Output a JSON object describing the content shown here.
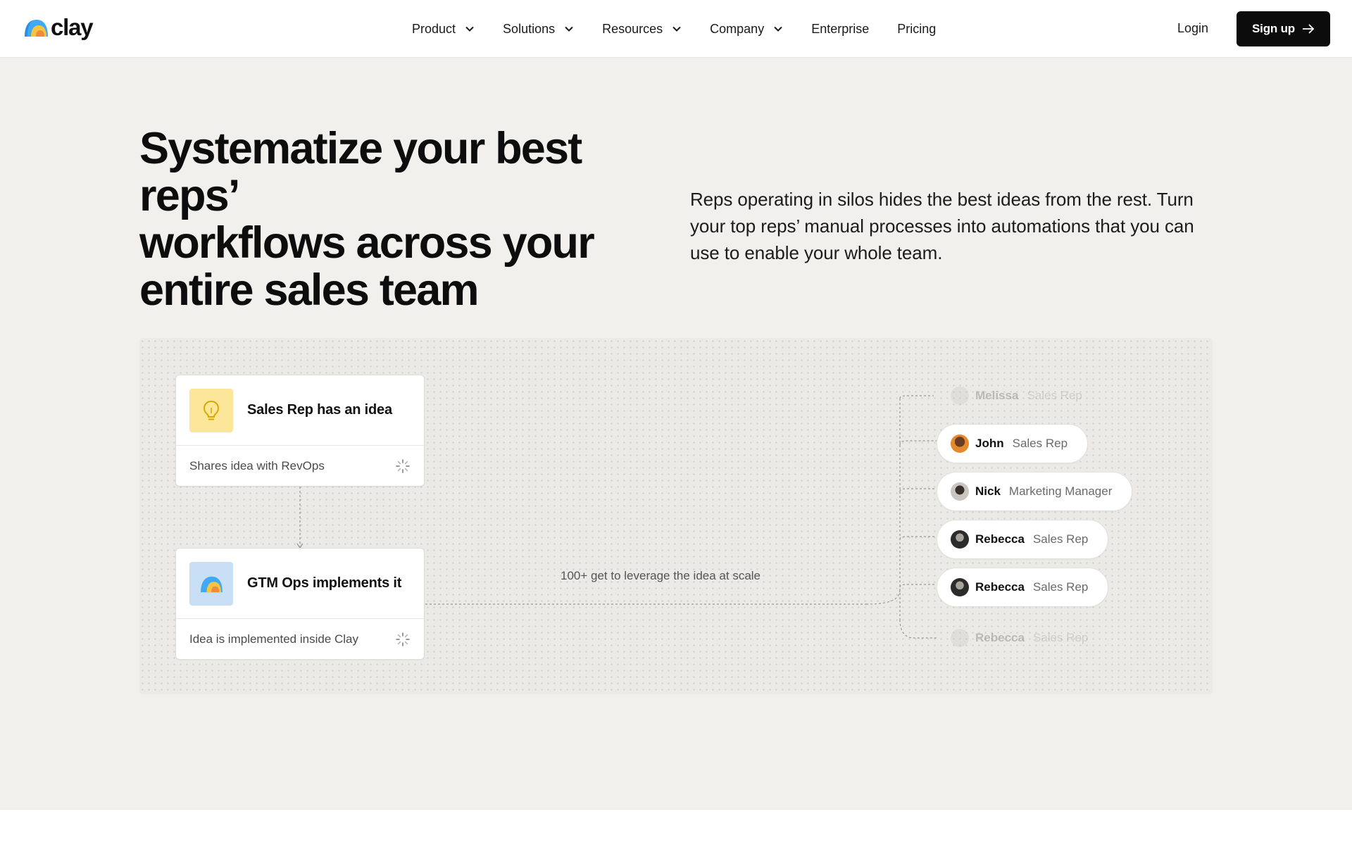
{
  "nav": {
    "logo_text": "clay",
    "items": [
      {
        "label": "Product",
        "has_dropdown": true
      },
      {
        "label": "Solutions",
        "has_dropdown": true
      },
      {
        "label": "Resources",
        "has_dropdown": true
      },
      {
        "label": "Company",
        "has_dropdown": true
      },
      {
        "label": "Enterprise",
        "has_dropdown": false
      },
      {
        "label": "Pricing",
        "has_dropdown": false
      }
    ],
    "login_label": "Login",
    "signup_label": "Sign up"
  },
  "hero": {
    "headline_lines": [
      "Systematize your best reps’",
      "workflows across your",
      "entire sales team"
    ],
    "subcopy": "Reps operating in silos hides the best ideas from the rest. Turn your top reps’ manual processes into automations that you can use to enable your whole team."
  },
  "diagram": {
    "card1": {
      "title": "Sales Rep has an idea",
      "subtitle": "Shares idea with RevOps",
      "icon": "lightbulb-icon"
    },
    "card2": {
      "title": "GTM Ops implements it",
      "subtitle": "Idea is implemented inside Clay",
      "icon": "clay-logo-icon"
    },
    "scale_label": "100+ get to leverage the idea at scale",
    "people": [
      {
        "name": "Melissa",
        "role": "Sales Rep",
        "faded": true
      },
      {
        "name": "John",
        "role": "Sales Rep",
        "faded": false
      },
      {
        "name": "Nick",
        "role": "Marketing Manager",
        "faded": false
      },
      {
        "name": "Rebecca",
        "role": "Sales Rep",
        "faded": false
      },
      {
        "name": "Rebecca",
        "role": "Sales Rep",
        "faded": false
      },
      {
        "name": "Rebecca",
        "role": "Sales Rep",
        "faded": true
      }
    ]
  },
  "colors": {
    "page_bg": "#f1f0ed",
    "cta_bg": "#0c0c0c",
    "idea_icon_bg": "#fbe69a",
    "ops_icon_bg": "#c9dff6"
  }
}
